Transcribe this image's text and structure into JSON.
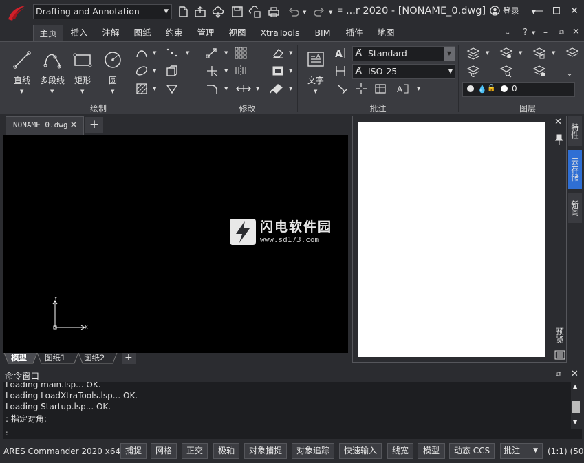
{
  "titlebar": {
    "workspace": "Drafting and Annotation",
    "doc_title": "...r 2020 - [NONAME_0.dwg]",
    "login": "登录",
    "controls": {
      "minimize": "—",
      "restore": "⧠",
      "close": "✕"
    }
  },
  "tabs": [
    "主页",
    "插入",
    "注解",
    "图纸",
    "约束",
    "管理",
    "视图",
    "XtraTools",
    "BIM",
    "插件",
    "地图"
  ],
  "active_tab": "主页",
  "ribbon": {
    "draw": {
      "title": "绘制",
      "line": "直线",
      "polyline": "多段线",
      "rectangle": "矩形",
      "circle": "圆"
    },
    "modify": {
      "title": "修改"
    },
    "annotate": {
      "title": "批注",
      "text": "文字",
      "text_style": "Standard",
      "dim_style": "ISO-25"
    },
    "layers": {
      "title": "图层",
      "current_layer": "0"
    }
  },
  "document": {
    "tab_name": "NONAME_0.dwg",
    "axis_y": "Y",
    "axis_x": "X"
  },
  "layout_tabs": [
    "模型",
    "图纸1",
    "图纸2"
  ],
  "side_tabs": [
    "特性",
    "云存储",
    "新闻"
  ],
  "preview_bottom_label": "预览",
  "watermark": {
    "name": "闪电软件园",
    "url": "www.sd173.com"
  },
  "command_window": {
    "title": "命令窗口",
    "lines": [
      "Loading main.lsp...  OK.",
      "Loading LoadXtraTools.lsp...  OK.",
      "Loading Startup.lsp...  OK.",
      ": 指定对角:"
    ],
    "prompt": ":"
  },
  "statusbar": {
    "app_name": "ARES Commander 2020 x64",
    "buttons": [
      "捕捉",
      "网格",
      "正交",
      "极轴",
      "对象捕捉",
      "对象追踪",
      "快速输入",
      "线宽",
      "模型",
      "动态 CCS"
    ],
    "annotation_dropdown": "批注",
    "scale": "(1:1)",
    "extra": "(50"
  },
  "colors": {
    "accent": "#2f6fd4",
    "logo": "#d0202a",
    "background": "#2b2c30",
    "ribbon": "#3a3b40"
  }
}
